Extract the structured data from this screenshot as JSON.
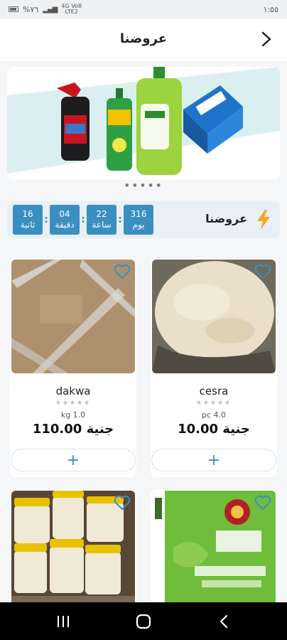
{
  "status_bar": {
    "time": "١:٥٥",
    "battery": "%٧٦",
    "network_top": "4G Vo8",
    "network_bottom": "LTE2"
  },
  "header": {
    "title": "عروضنا"
  },
  "offers": {
    "label": "عروضنا",
    "timer": [
      {
        "value": "16",
        "unit": "ثانية"
      },
      {
        "value": "04",
        "unit": "دقيقة"
      },
      {
        "value": "22",
        "unit": "ساعة"
      },
      {
        "value": "316",
        "unit": "يوم"
      }
    ]
  },
  "products": [
    {
      "name": "cesra",
      "unit": "pc 4.0",
      "price": "جنية 10.00"
    },
    {
      "name": "dakwa",
      "unit": "kg 1.0",
      "price": "جنية 110.00"
    }
  ],
  "colors": {
    "accent": "#3a8fc0",
    "bolt": "#f5a623"
  }
}
